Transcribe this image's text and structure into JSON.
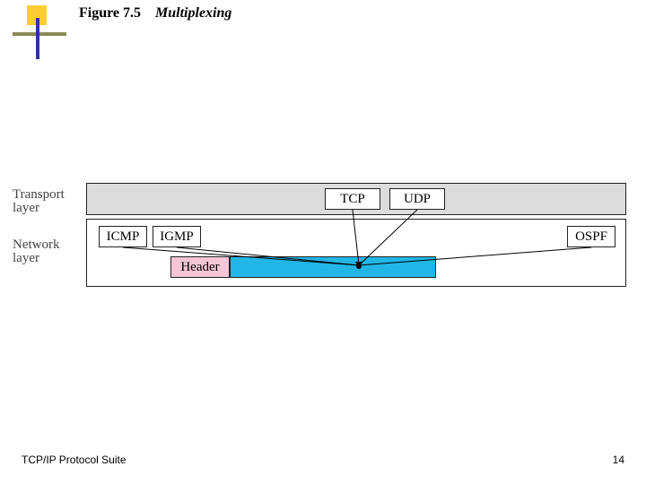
{
  "title": {
    "fignum": "Figure 7.5",
    "figname": "Multiplexing"
  },
  "layers": {
    "transport_label": "Transport\nlayer",
    "network_label": "Network\nlayer"
  },
  "protocols": {
    "tcp": "TCP",
    "udp": "UDP",
    "icmp": "ICMP",
    "igmp": "IGMP",
    "ospf": "OSPF",
    "header": "Header"
  },
  "footer": "TCP/IP Protocol Suite",
  "page_number": "14"
}
